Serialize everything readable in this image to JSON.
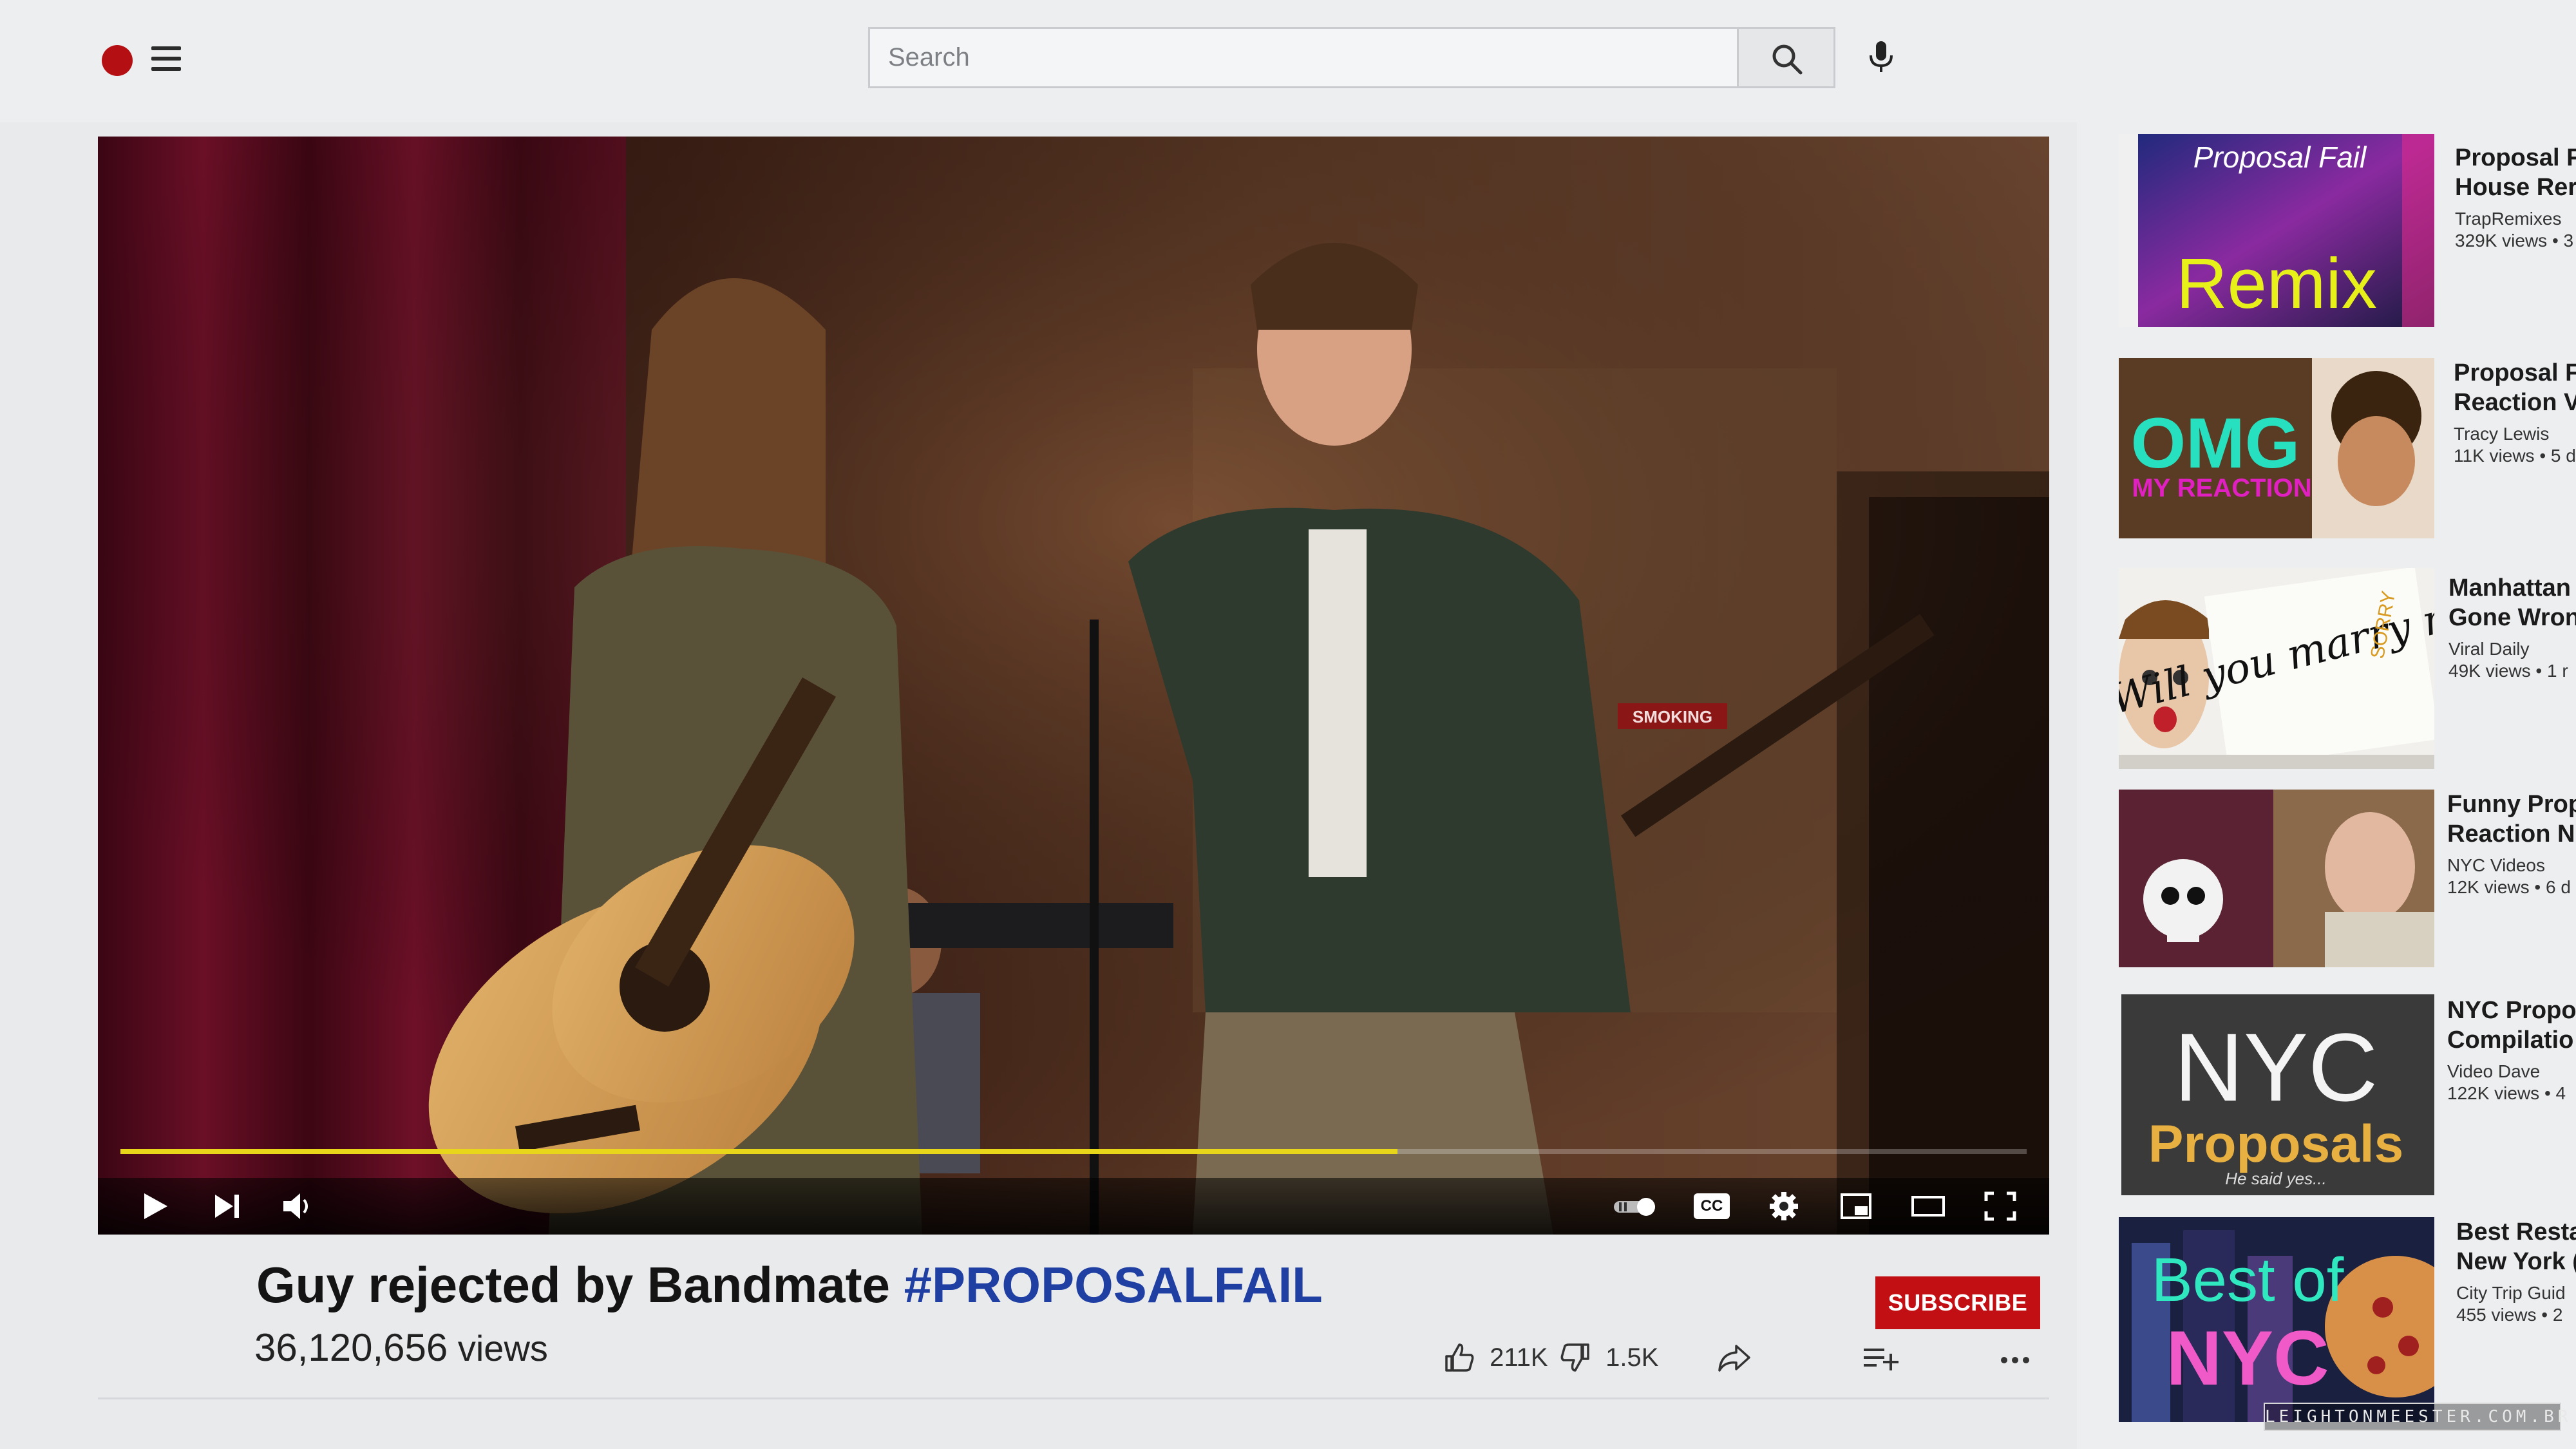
{
  "header": {
    "search_placeholder": "Search",
    "logo_icon": "logo-dot-icon",
    "menu_icon": "hamburger-menu-icon",
    "search_icon": "search-icon",
    "mic_icon": "microphone-icon"
  },
  "player": {
    "progress_fraction": 0.67,
    "progress_color": "#e8d61a",
    "sign_text": "SMOKING",
    "controls": [
      "play-icon",
      "next-icon",
      "volume-icon",
      "autoplay-toggle-icon",
      "captions-icon",
      "settings-icon",
      "miniplayer-icon",
      "theater-mode-icon",
      "fullscreen-icon"
    ],
    "cc_label": "CC"
  },
  "video": {
    "title_main": "Guy rejected by Bandmate",
    "title_hashtag": "#PROPOSALFAIL",
    "views_number": "36,120,656",
    "views_label": "views",
    "likes": "211K",
    "dislikes": "1.5K",
    "subscribe_label": "SUBSCRIBE"
  },
  "sidebar": {
    "items": [
      {
        "title1": "Proposal F",
        "title2": "House Rer",
        "channel": "TrapRemixes",
        "stats": "329K views • 3",
        "thumb_text1": "Proposal Fail",
        "thumb_text2": "Remix"
      },
      {
        "title1": "Proposal F",
        "title2": "Reaction V",
        "channel": "Tracy Lewis",
        "stats": "11K views • 5 d",
        "thumb_text1": "OMG",
        "thumb_text2": "MY REACTION"
      },
      {
        "title1": "Manhattan",
        "title2": "Gone Wron",
        "channel": "Viral Daily",
        "stats": "49K views • 1 r",
        "thumb_text1": "Will you marry me?",
        "thumb_text2": "SORRY"
      },
      {
        "title1": "Funny Prop",
        "title2": "Reaction N",
        "channel": "NYC Videos",
        "stats": "12K views • 6 d",
        "thumb_text1": "",
        "thumb_text2": ""
      },
      {
        "title1": "NYC Propo",
        "title2": "Compilatio",
        "channel": "Video Dave",
        "stats": "122K views • 4",
        "thumb_text1": "NYC",
        "thumb_text2": "Proposals",
        "thumb_text3": "He said yes..."
      },
      {
        "title1": "Best Resta",
        "title2": "New York (",
        "channel": "City Trip Guid",
        "stats": "455 views • 2",
        "thumb_text1": "Best of",
        "thumb_text2": "NYC"
      }
    ]
  },
  "watermark": "LEIGHTONMEESTER.COM.BR"
}
